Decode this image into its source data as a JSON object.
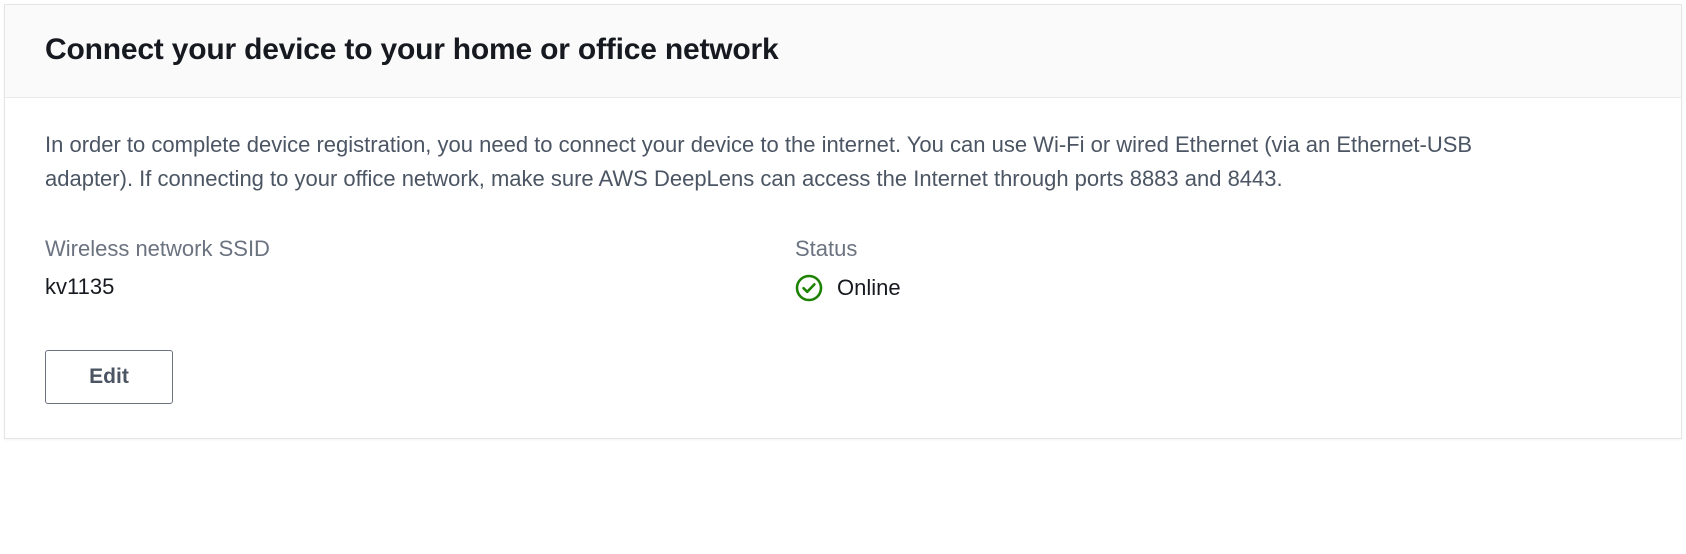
{
  "panel": {
    "title": "Connect your device to your home or office network",
    "description": "In order to complete device registration, you need to connect your device to the internet. You can use Wi-Fi or wired Ethernet (via an Ethernet-USB adapter). If connecting to your office network, make sure AWS DeepLens can access the Internet through ports 8883 and 8443."
  },
  "network": {
    "ssid_label": "Wireless network SSID",
    "ssid_value": "kv1135",
    "status_label": "Status",
    "status_value": "Online",
    "status_color": "#1d8102"
  },
  "actions": {
    "edit_label": "Edit"
  }
}
